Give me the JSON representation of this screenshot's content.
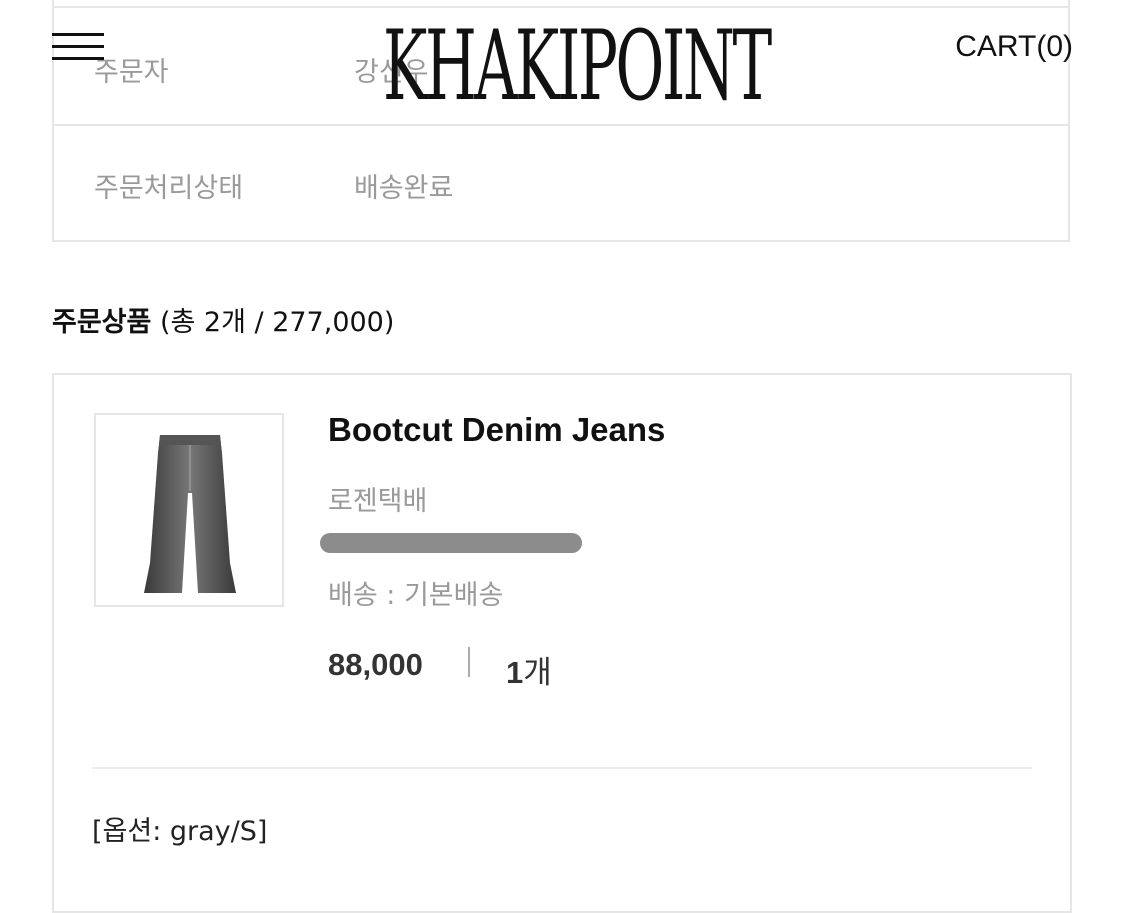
{
  "header": {
    "logo": "KHAKIPOINT",
    "cart_label": "CART(0)"
  },
  "order_info": {
    "rows": [
      {
        "label": "주문자",
        "value": "강신우"
      },
      {
        "label": "주문처리상태",
        "value": "배송완료"
      }
    ]
  },
  "section": {
    "title": "주문상품",
    "summary": "(총 2개 / 277,000)"
  },
  "product": {
    "name": "Bootcut Denim Jeans",
    "courier": "로젠택배",
    "shipping": "배송 : 기본배송",
    "price": "88,000",
    "quantity": "1",
    "quantity_unit": "개",
    "option": "[옵션: gray/S]"
  },
  "colors": {
    "border": "#e6e6e6",
    "muted_text": "#9a9a9a",
    "text": "#111111"
  }
}
